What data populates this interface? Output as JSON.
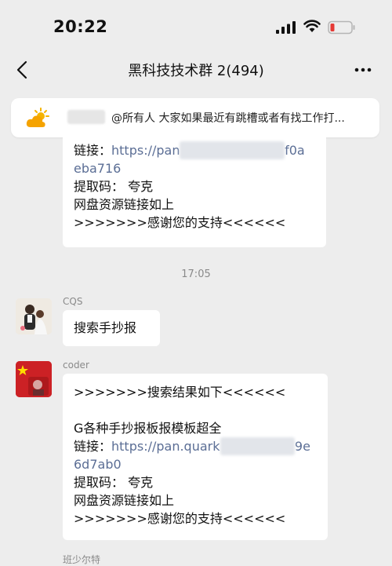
{
  "status_bar": {
    "time": "20:22"
  },
  "nav": {
    "title": "黑科技技术群 2(494)"
  },
  "announcement": {
    "text": "@所有人 大家如果最近有跳槽或者有找工作打..."
  },
  "messages": {
    "first": {
      "link_label": "链接：",
      "link_start": "https://pan",
      "link_end": "f0a",
      "link_line2": "eba716",
      "code_line": "提取码：  夸克",
      "note": "网盘资源链接如上",
      "thanks": ">>>>>>>感谢您的支持<<<<<<"
    },
    "timestamp": "17:05",
    "cqs": {
      "name": "CQS",
      "text": "搜索手抄报"
    },
    "coder": {
      "name": "coder",
      "header": ">>>>>>>搜索结果如下<<<<<<",
      "title": "G各种手抄报板报模板超全",
      "link_label": "链接：",
      "link_start": "https://pan.quark",
      "link_end": "9e",
      "link_line2": "6d7ab0",
      "code_line": "提取码：  夸克",
      "note": "网盘资源链接如上",
      "thanks": ">>>>>>>感谢您的支持<<<<<<"
    },
    "next_sender": "班少尔特"
  }
}
